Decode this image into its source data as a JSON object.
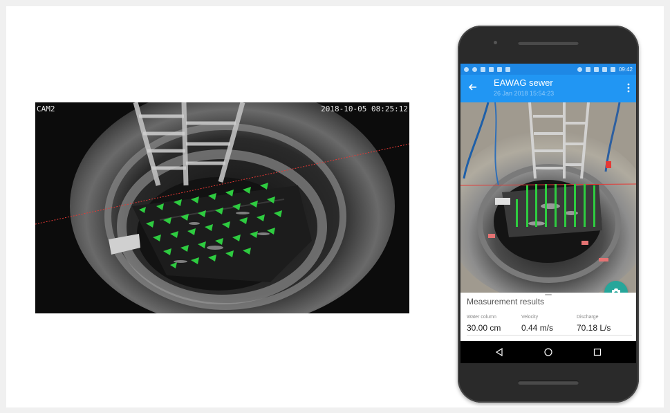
{
  "camera": {
    "label": "CAM2",
    "timestamp": "2018-10-05 08:25:12"
  },
  "app": {
    "title": "EAWAG sewer",
    "subtitle": "26 Jan 2018 15:54:23",
    "status_time": "09:42",
    "accent_color": "#2196f3",
    "fab_color": "#26a69a"
  },
  "results": {
    "title": "Measurement results",
    "metrics": [
      {
        "label": "Water column",
        "value": "30.00 cm"
      },
      {
        "label": "Velocity",
        "value": "0.44 m/s"
      },
      {
        "label": "Discharge",
        "value": "70.18 L/s"
      }
    ]
  },
  "icons": {
    "back": "back-arrow-icon",
    "more": "more-vert-icon",
    "camera": "camera-icon",
    "nav_back": "nav-back-icon",
    "nav_home": "nav-home-icon",
    "nav_recent": "nav-recent-icon"
  }
}
